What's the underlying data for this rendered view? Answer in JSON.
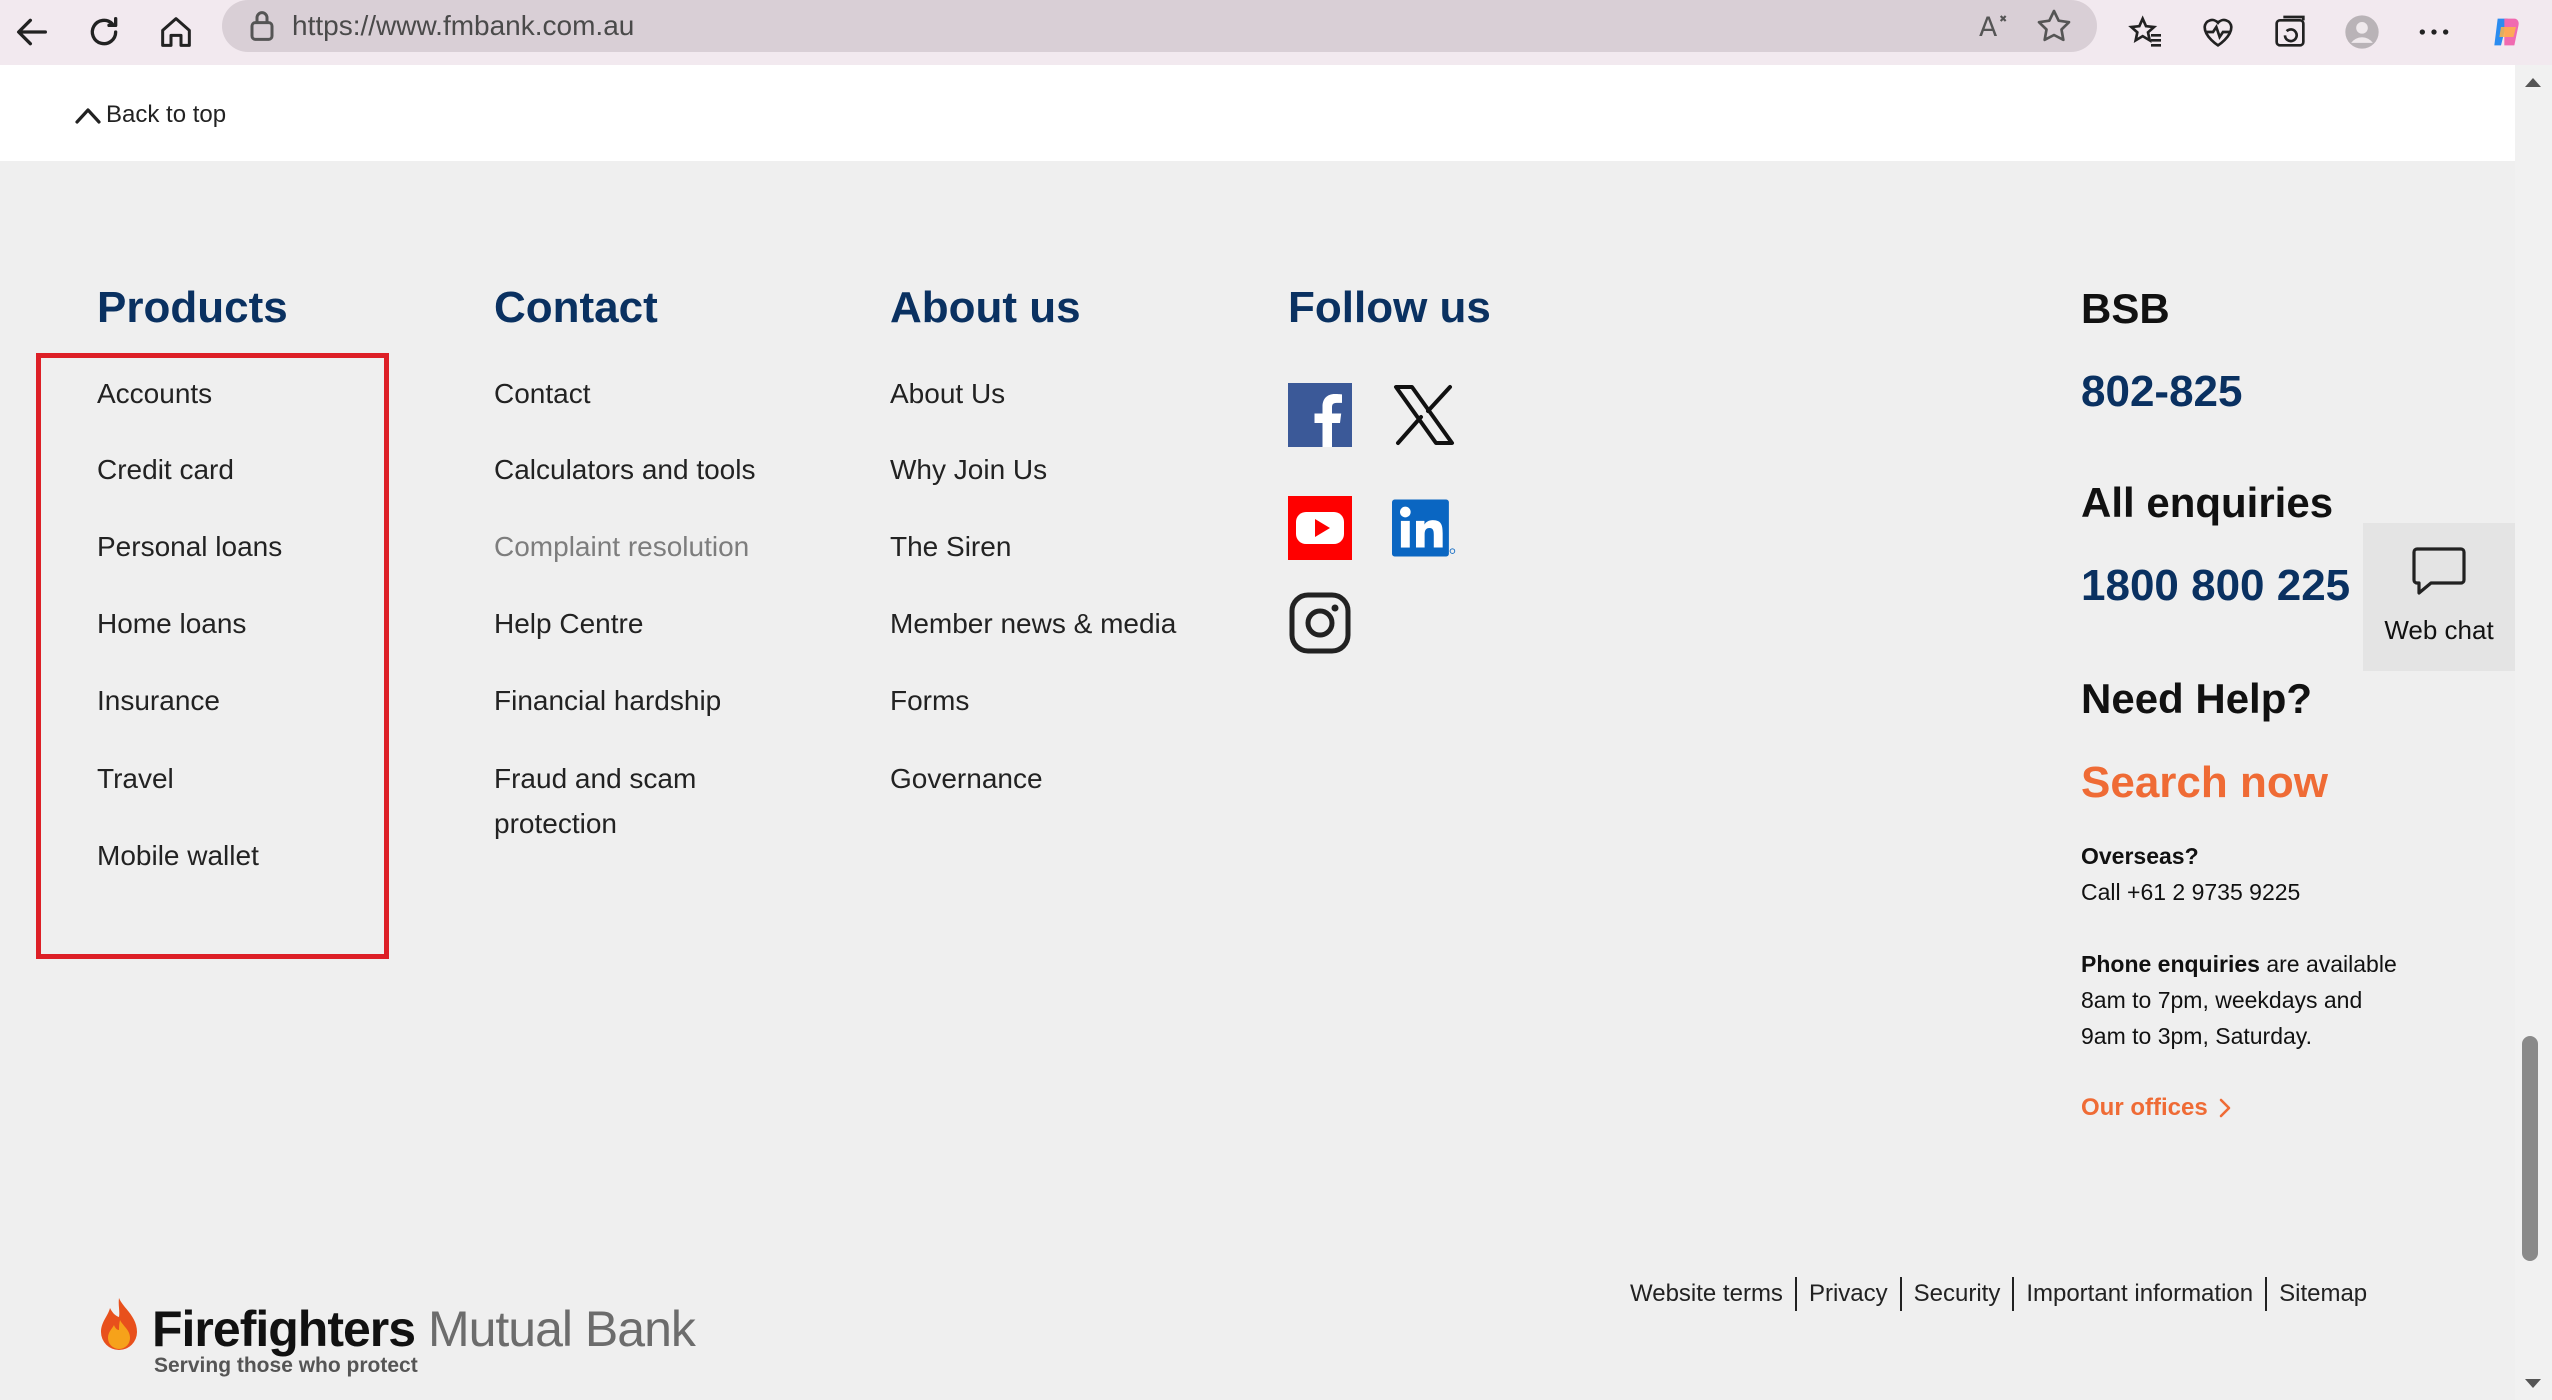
{
  "browser": {
    "url": "https://www.fmbank.com.au",
    "read_aloud_label": "Aͅ"
  },
  "page": {
    "back_to_top": "Back to top"
  },
  "footer": {
    "products": {
      "title": "Products",
      "links": [
        "Accounts",
        "Credit card",
        "Personal loans",
        "Home loans",
        "Insurance",
        "Travel",
        "Mobile wallet"
      ]
    },
    "contact": {
      "title": "Contact",
      "links": [
        "Contact",
        "Calculators and tools",
        "Complaint resolution",
        "Help Centre",
        "Financial hardship",
        "Fraud and scam",
        "protection"
      ]
    },
    "about": {
      "title": "About us",
      "links": [
        "About Us",
        "Why Join Us",
        "The Siren",
        "Member news & media",
        "Forms",
        "Governance"
      ]
    },
    "follow": {
      "title": "Follow us",
      "icons": [
        "facebook-icon",
        "x-twitter-icon",
        "youtube-icon",
        "linkedin-icon",
        "instagram-icon"
      ]
    },
    "bsb": {
      "title": "BSB",
      "number": "802-825",
      "enquiries_title": "All enquiries",
      "enquiries_number": "1800 800 225",
      "help_title": "Need Help?",
      "search_now": "Search now",
      "overseas_label": "Overseas?",
      "overseas_call": "Call +61 2 9735 9225",
      "phone_bold": "Phone enquiries",
      "phone_rest": " are available",
      "phone_line2": "8am to 7pm, weekdays and",
      "phone_line3": "9am to 3pm, Saturday.",
      "our_offices": "Our offices"
    },
    "webchat": "Web chat",
    "logo": {
      "name_bold": "Firefighters",
      "name_light": " Mutual Bank",
      "tagline": "Serving those who protect"
    },
    "legal": [
      "Website terms",
      "Privacy",
      "Security",
      "Important information",
      "Sitemap"
    ]
  },
  "colors": {
    "navy": "#0a3161",
    "orange": "#ef6b35",
    "highlight_red": "#dd1f26",
    "footer_bg": "#efefef"
  }
}
